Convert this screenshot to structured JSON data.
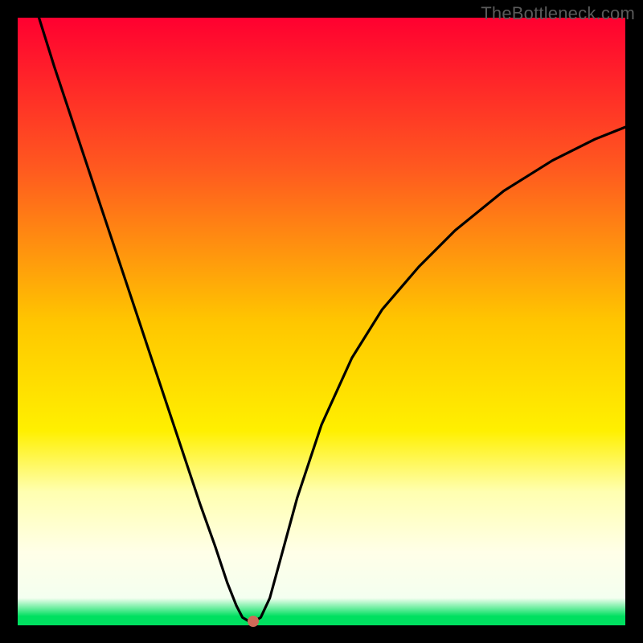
{
  "watermark": "TheBottleneck.com",
  "colors": {
    "frame": "#000000",
    "curve_stroke": "#000000",
    "marker_fill": "#cf6a58",
    "green_band": "#00e060"
  },
  "chart_data": {
    "type": "line",
    "title": "",
    "xlabel": "",
    "ylabel": "",
    "xlim": [
      0,
      100
    ],
    "ylim": [
      0,
      100
    ],
    "grid": false,
    "legend": false,
    "gradient_stops": [
      {
        "pos": 0.0,
        "color": "#ff0030"
      },
      {
        "pos": 0.25,
        "color": "#ff5a1f"
      },
      {
        "pos": 0.5,
        "color": "#ffc600"
      },
      {
        "pos": 0.68,
        "color": "#fff000"
      },
      {
        "pos": 0.78,
        "color": "#ffffb0"
      },
      {
        "pos": 0.88,
        "color": "#ffffe8"
      },
      {
        "pos": 0.955,
        "color": "#f4fff0"
      },
      {
        "pos": 0.985,
        "color": "#00e060"
      },
      {
        "pos": 1.0,
        "color": "#00e060"
      }
    ],
    "series": [
      {
        "name": "curve",
        "x": [
          3.5,
          6,
          10,
          14,
          18,
          22,
          26,
          30,
          32.5,
          34.5,
          36,
          37,
          38,
          38.8,
          40,
          41.5,
          43,
          46,
          50,
          55,
          60,
          66,
          72,
          80,
          88,
          95,
          100
        ],
        "y": [
          100,
          92,
          80,
          68,
          56,
          44,
          32,
          20,
          13,
          7,
          3.2,
          1.3,
          0.7,
          0.6,
          1.3,
          4.5,
          10,
          21,
          33,
          44,
          52,
          59,
          65,
          71.5,
          76.5,
          80,
          82
        ]
      }
    ],
    "marker": {
      "x": 38.8,
      "y": 0.6
    }
  }
}
